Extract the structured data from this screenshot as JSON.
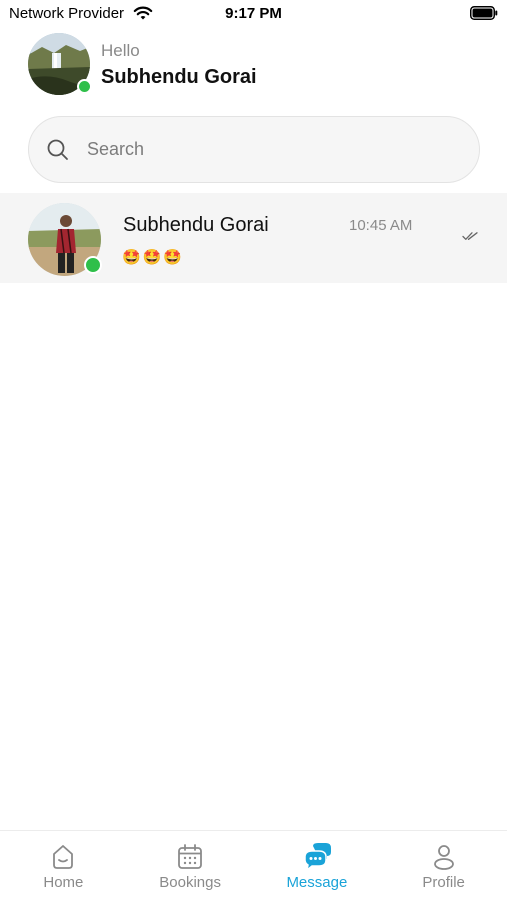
{
  "status_bar": {
    "carrier": "Network Provider",
    "time": "9:17 PM",
    "wifi_icon": "wifi-icon",
    "battery_icon": "battery-icon"
  },
  "header": {
    "greeting": "Hello",
    "user_name": "Subhendu Gorai",
    "online": true
  },
  "search": {
    "placeholder": "Search",
    "icon": "search-icon"
  },
  "chats": [
    {
      "name": "Subhendu Gorai",
      "time": "10:45 AM",
      "preview": "🤩🤩🤩",
      "online": true,
      "status_icon": "double-check-icon"
    }
  ],
  "tab_bar": {
    "tabs": [
      {
        "label": "Home",
        "icon": "home-icon",
        "active": false
      },
      {
        "label": "Bookings",
        "icon": "calendar-icon",
        "active": false
      },
      {
        "label": "Message",
        "icon": "chat-bubbles-icon",
        "active": true
      },
      {
        "label": "Profile",
        "icon": "person-icon",
        "active": false
      }
    ]
  },
  "colors": {
    "accent": "#1aa3d8",
    "online": "#2fbf4a",
    "muted_text": "#8a8a8a",
    "row_highlight": "#f5f5f5"
  }
}
